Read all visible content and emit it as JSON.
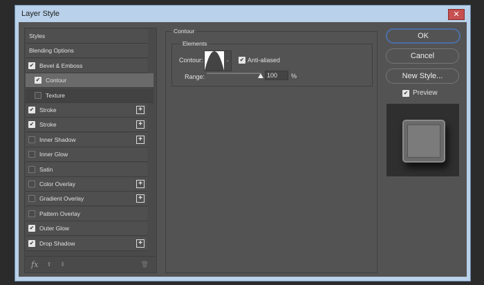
{
  "window": {
    "title": "Layer Style",
    "close": "✕"
  },
  "styles_list": [
    {
      "label": "Styles",
      "type": "header"
    },
    {
      "label": "Blending Options",
      "type": "header"
    },
    {
      "label": "Bevel & Emboss",
      "checked": true
    },
    {
      "label": "Contour",
      "checked": true,
      "sub": true,
      "selected": true
    },
    {
      "label": "Texture",
      "checked": false,
      "sub": true
    },
    {
      "label": "Stroke",
      "checked": true,
      "plus": true
    },
    {
      "label": "Stroke",
      "checked": true,
      "plus": true
    },
    {
      "label": "Inner Shadow",
      "checked": false,
      "plus": true
    },
    {
      "label": "Inner Glow",
      "checked": false
    },
    {
      "label": "Satin",
      "checked": false
    },
    {
      "label": "Color Overlay",
      "checked": false,
      "plus": true
    },
    {
      "label": "Gradient Overlay",
      "checked": false,
      "plus": true
    },
    {
      "label": "Pattern Overlay",
      "checked": false
    },
    {
      "label": "Outer Glow",
      "checked": true
    },
    {
      "label": "Drop Shadow",
      "checked": true,
      "plus": true
    }
  ],
  "toolbar": {
    "fx": "fx"
  },
  "contour": {
    "section": "Contour",
    "group": "Elements",
    "contour_label": "Contour:",
    "anti_aliased_label": "Anti-aliased",
    "anti_aliased": true,
    "range_label": "Range:",
    "range_value": "100",
    "range_unit": "%",
    "range_percent": 100
  },
  "buttons": {
    "ok": "OK",
    "cancel": "Cancel",
    "new_style": "New Style...",
    "preview_label": "Preview",
    "preview": true
  }
}
